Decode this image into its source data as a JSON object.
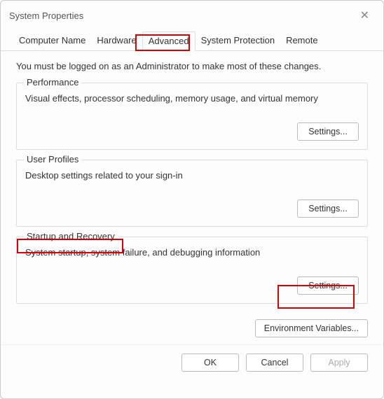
{
  "window": {
    "title": "System Properties"
  },
  "tabs": {
    "items": [
      {
        "label": "Computer Name"
      },
      {
        "label": "Hardware"
      },
      {
        "label": "Advanced"
      },
      {
        "label": "System Protection"
      },
      {
        "label": "Remote"
      }
    ]
  },
  "intro": "You must be logged on as an Administrator to make most of these changes.",
  "sections": {
    "performance": {
      "legend": "Performance",
      "desc": "Visual effects, processor scheduling, memory usage, and virtual memory",
      "button": "Settings..."
    },
    "userprofiles": {
      "legend": "User Profiles",
      "desc": "Desktop settings related to your sign-in",
      "button": "Settings..."
    },
    "startup": {
      "legend": "Startup and Recovery",
      "desc": "System startup, system failure, and debugging information",
      "button": "Settings..."
    }
  },
  "env_button": "Environment Variables...",
  "dialog": {
    "ok": "OK",
    "cancel": "Cancel",
    "apply": "Apply"
  }
}
